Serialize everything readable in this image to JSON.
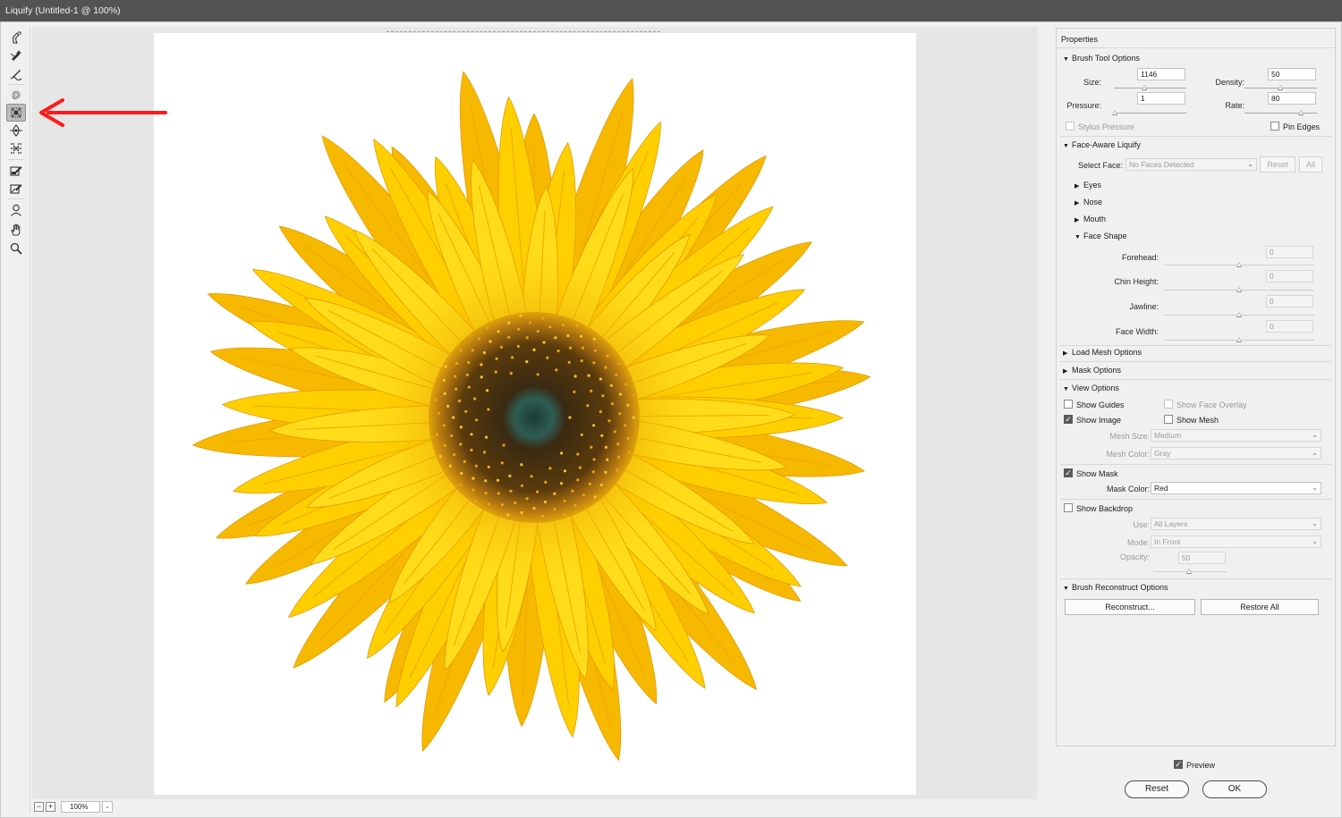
{
  "window": {
    "title": "Liquify (Untitled-1 @ 100%)"
  },
  "toolbar": {
    "tools": [
      {
        "name": "forward-warp-tool-icon"
      },
      {
        "name": "reconstruct-tool-icon"
      },
      {
        "name": "smooth-tool-icon"
      },
      {
        "name": "twirl-clockwise-tool-icon"
      },
      {
        "name": "pucker-tool-icon",
        "active": true
      },
      {
        "name": "bloat-tool-icon"
      },
      {
        "name": "push-left-tool-icon"
      },
      {
        "name": "freeze-mask-tool-icon"
      },
      {
        "name": "thaw-mask-tool-icon"
      },
      {
        "name": "face-tool-icon"
      },
      {
        "name": "hand-tool-icon"
      },
      {
        "name": "zoom-tool-icon"
      }
    ]
  },
  "annotation": {
    "arrow_color": "#ff1a1a"
  },
  "zoom": {
    "minus": "−",
    "plus": "+",
    "value": "100%"
  },
  "properties": {
    "title": "Properties",
    "brush_tool_options": {
      "header": "Brush Tool Options",
      "size_label": "Size:",
      "size_value": "1146",
      "density_label": "Density:",
      "density_value": "50",
      "pressure_label": "Pressure:",
      "pressure_value": "1",
      "rate_label": "Rate:",
      "rate_value": "80",
      "stylus_pressure": "Stylus Pressure",
      "pin_edges": "Pin Edges"
    },
    "face_aware": {
      "header": "Face-Aware Liquify",
      "select_face_label": "Select Face:",
      "select_face_value": "No Faces Detected",
      "reset": "Reset",
      "all": "All",
      "eyes": "Eyes",
      "nose": "Nose",
      "mouth": "Mouth",
      "face_shape": "Face Shape",
      "forehead_label": "Forehead:",
      "forehead_value": "0",
      "chin_label": "Chin Height:",
      "chin_value": "0",
      "jawline_label": "Jawline:",
      "jawline_value": "0",
      "face_width_label": "Face Width:",
      "face_width_value": "0"
    },
    "load_mesh": "Load Mesh Options",
    "mask_options": "Mask Options",
    "view_options": {
      "header": "View Options",
      "show_guides": "Show Guides",
      "show_face_overlay": "Show Face Overlay",
      "show_image": "Show Image",
      "show_mesh": "Show Mesh",
      "mesh_size_label": "Mesh Size:",
      "mesh_size_value": "Medium",
      "mesh_color_label": "Mesh Color:",
      "mesh_color_value": "Gray",
      "show_mask": "Show Mask",
      "mask_color_label": "Mask Color:",
      "mask_color_value": "Red",
      "show_backdrop": "Show Backdrop",
      "use_label": "Use:",
      "use_value": "All Layers",
      "mode_label": "Mode:",
      "mode_value": "In Front",
      "opacity_label": "Opacity:",
      "opacity_value": "50"
    },
    "brush_reconstruct": {
      "header": "Brush Reconstruct Options",
      "reconstruct": "Reconstruct...",
      "restore_all": "Restore All"
    }
  },
  "footer": {
    "preview": "Preview",
    "reset": "Reset",
    "ok": "OK"
  }
}
